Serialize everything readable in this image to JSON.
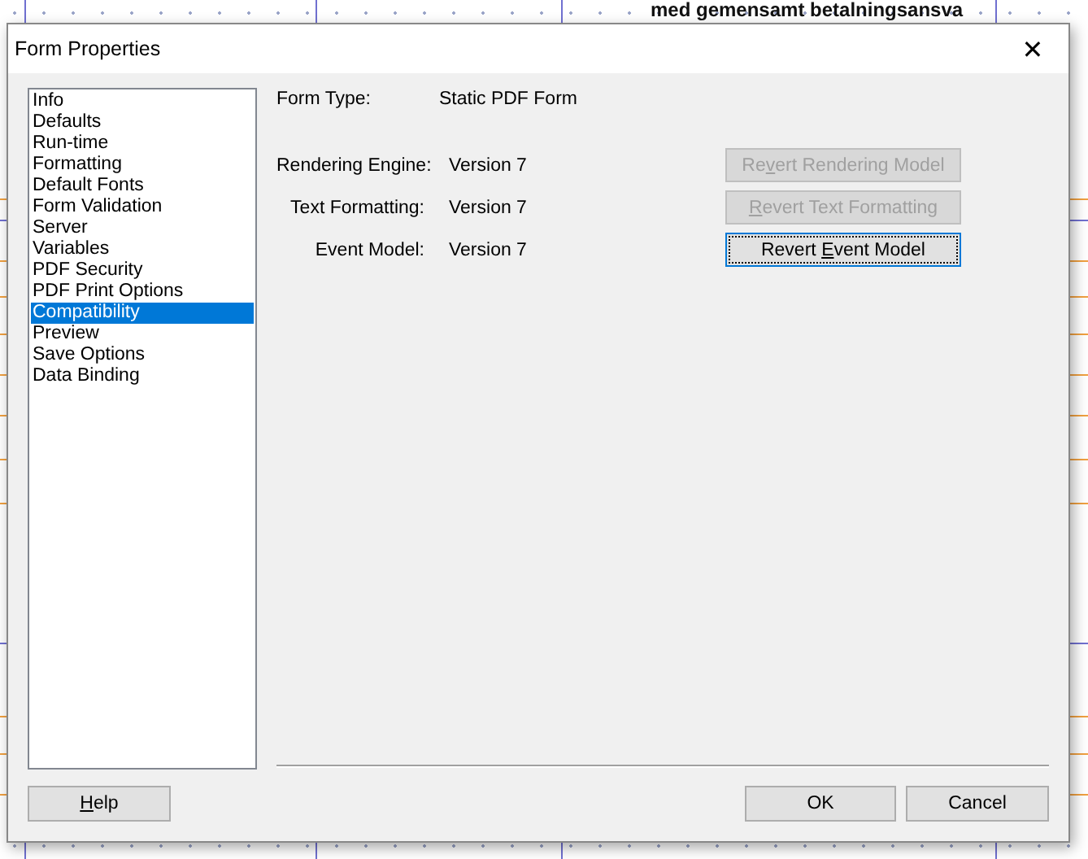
{
  "background_document": {
    "heading": "med gemensamt betalningsansva"
  },
  "dialog": {
    "title": "Form Properties",
    "close": "✕",
    "sidebar": {
      "items": [
        {
          "label": "Info",
          "selected": false
        },
        {
          "label": "Defaults",
          "selected": false
        },
        {
          "label": "Run-time",
          "selected": false
        },
        {
          "label": "Formatting",
          "selected": false
        },
        {
          "label": "Default Fonts",
          "selected": false
        },
        {
          "label": "Form Validation",
          "selected": false
        },
        {
          "label": "Server",
          "selected": false
        },
        {
          "label": "Variables",
          "selected": false
        },
        {
          "label": "PDF Security",
          "selected": false
        },
        {
          "label": "PDF Print Options",
          "selected": false
        },
        {
          "label": "Compatibility",
          "selected": true
        },
        {
          "label": "Preview",
          "selected": false
        },
        {
          "label": "Save Options",
          "selected": false
        },
        {
          "label": "Data Binding",
          "selected": false
        }
      ]
    },
    "form_type": {
      "label": "Form Type:",
      "value": "Static PDF Form"
    },
    "rows": [
      {
        "label": "Rendering Engine:",
        "value": "Version 7",
        "button": {
          "label_parts": {
            "before": "Re",
            "key": "v",
            "after": "ert Rendering Model"
          },
          "disabled": true,
          "focused": false
        }
      },
      {
        "label": "Text Formatting:",
        "value": "Version 7",
        "button": {
          "label_parts": {
            "key": "R",
            "after": "evert Text Formatting"
          },
          "disabled": true,
          "focused": false
        }
      },
      {
        "label": "Event Model:",
        "value": "Version 7",
        "button": {
          "label_parts": {
            "before": "Revert ",
            "key": "E",
            "after": "vent Model"
          },
          "disabled": false,
          "focused": true
        }
      }
    ],
    "footer": {
      "help": {
        "label_parts": {
          "key": "H",
          "after": "elp"
        }
      },
      "ok": "OK",
      "cancel": "Cancel"
    }
  }
}
